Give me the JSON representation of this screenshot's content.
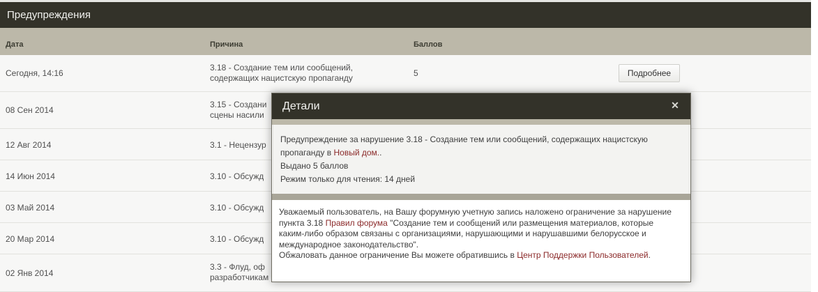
{
  "page": {
    "title": "Предупреждения"
  },
  "table": {
    "headers": {
      "date": "Дата",
      "reason": "Причина",
      "points": "Баллов"
    },
    "rows": [
      {
        "date": "Сегодня, 14:16",
        "reason": "3.18 - Создание тем или сообщений, содержащих нацистскую пропаганду",
        "points": "5",
        "button": "Подробнее"
      },
      {
        "date": "08 Сен 2014",
        "reason": "3.15 - Создани сцены насили",
        "points": ""
      },
      {
        "date": "12 Авг 2014",
        "reason": "3.1 - Нецензур",
        "points": ""
      },
      {
        "date": "14 Июн 2014",
        "reason": "3.10 - Обсужд",
        "points": ""
      },
      {
        "date": "03 Май 2014",
        "reason": "3.10 - Обсужд",
        "points": ""
      },
      {
        "date": "20 Мар 2014",
        "reason": "3.10 - Обсужд",
        "points": ""
      },
      {
        "date": "02 Янв 2014",
        "reason": "3.3 - Флуд, оф разработчикам",
        "points": ""
      }
    ]
  },
  "modal": {
    "title": "Детали",
    "close_icon": "close-icon",
    "warning_prefix": "Предупреждение за нарушение 3.18 - Создание тем или сообщений, содержащих нацистскую пропаганду в ",
    "warning_link": "Новый дом.",
    "warning_suffix": ".",
    "points_line": "Выдано 5 баллов",
    "readonly_line": "Режим только для чтения: 14 дней",
    "notice_prefix": "Уважаемый пользователь, на Вашу форумную учетную запись наложено ограничение за нарушение пункта 3.18 ",
    "notice_link": "Правил форума",
    "notice_suffix": " \"Создание тем и сообщений или размещения материалов, которые каким-либо образом связаны с организациями, нарушающими и нарушавшими белорусское и международное законодательство\".",
    "appeal_prefix": "Обжаловать данное ограничение Вы можете обратившись в ",
    "appeal_link": "Центр Поддержки Пользователей",
    "appeal_suffix": "."
  },
  "colors": {
    "title_bar": "#333229",
    "header_row": "#bcb8a9",
    "link": "#8b2a2a"
  }
}
